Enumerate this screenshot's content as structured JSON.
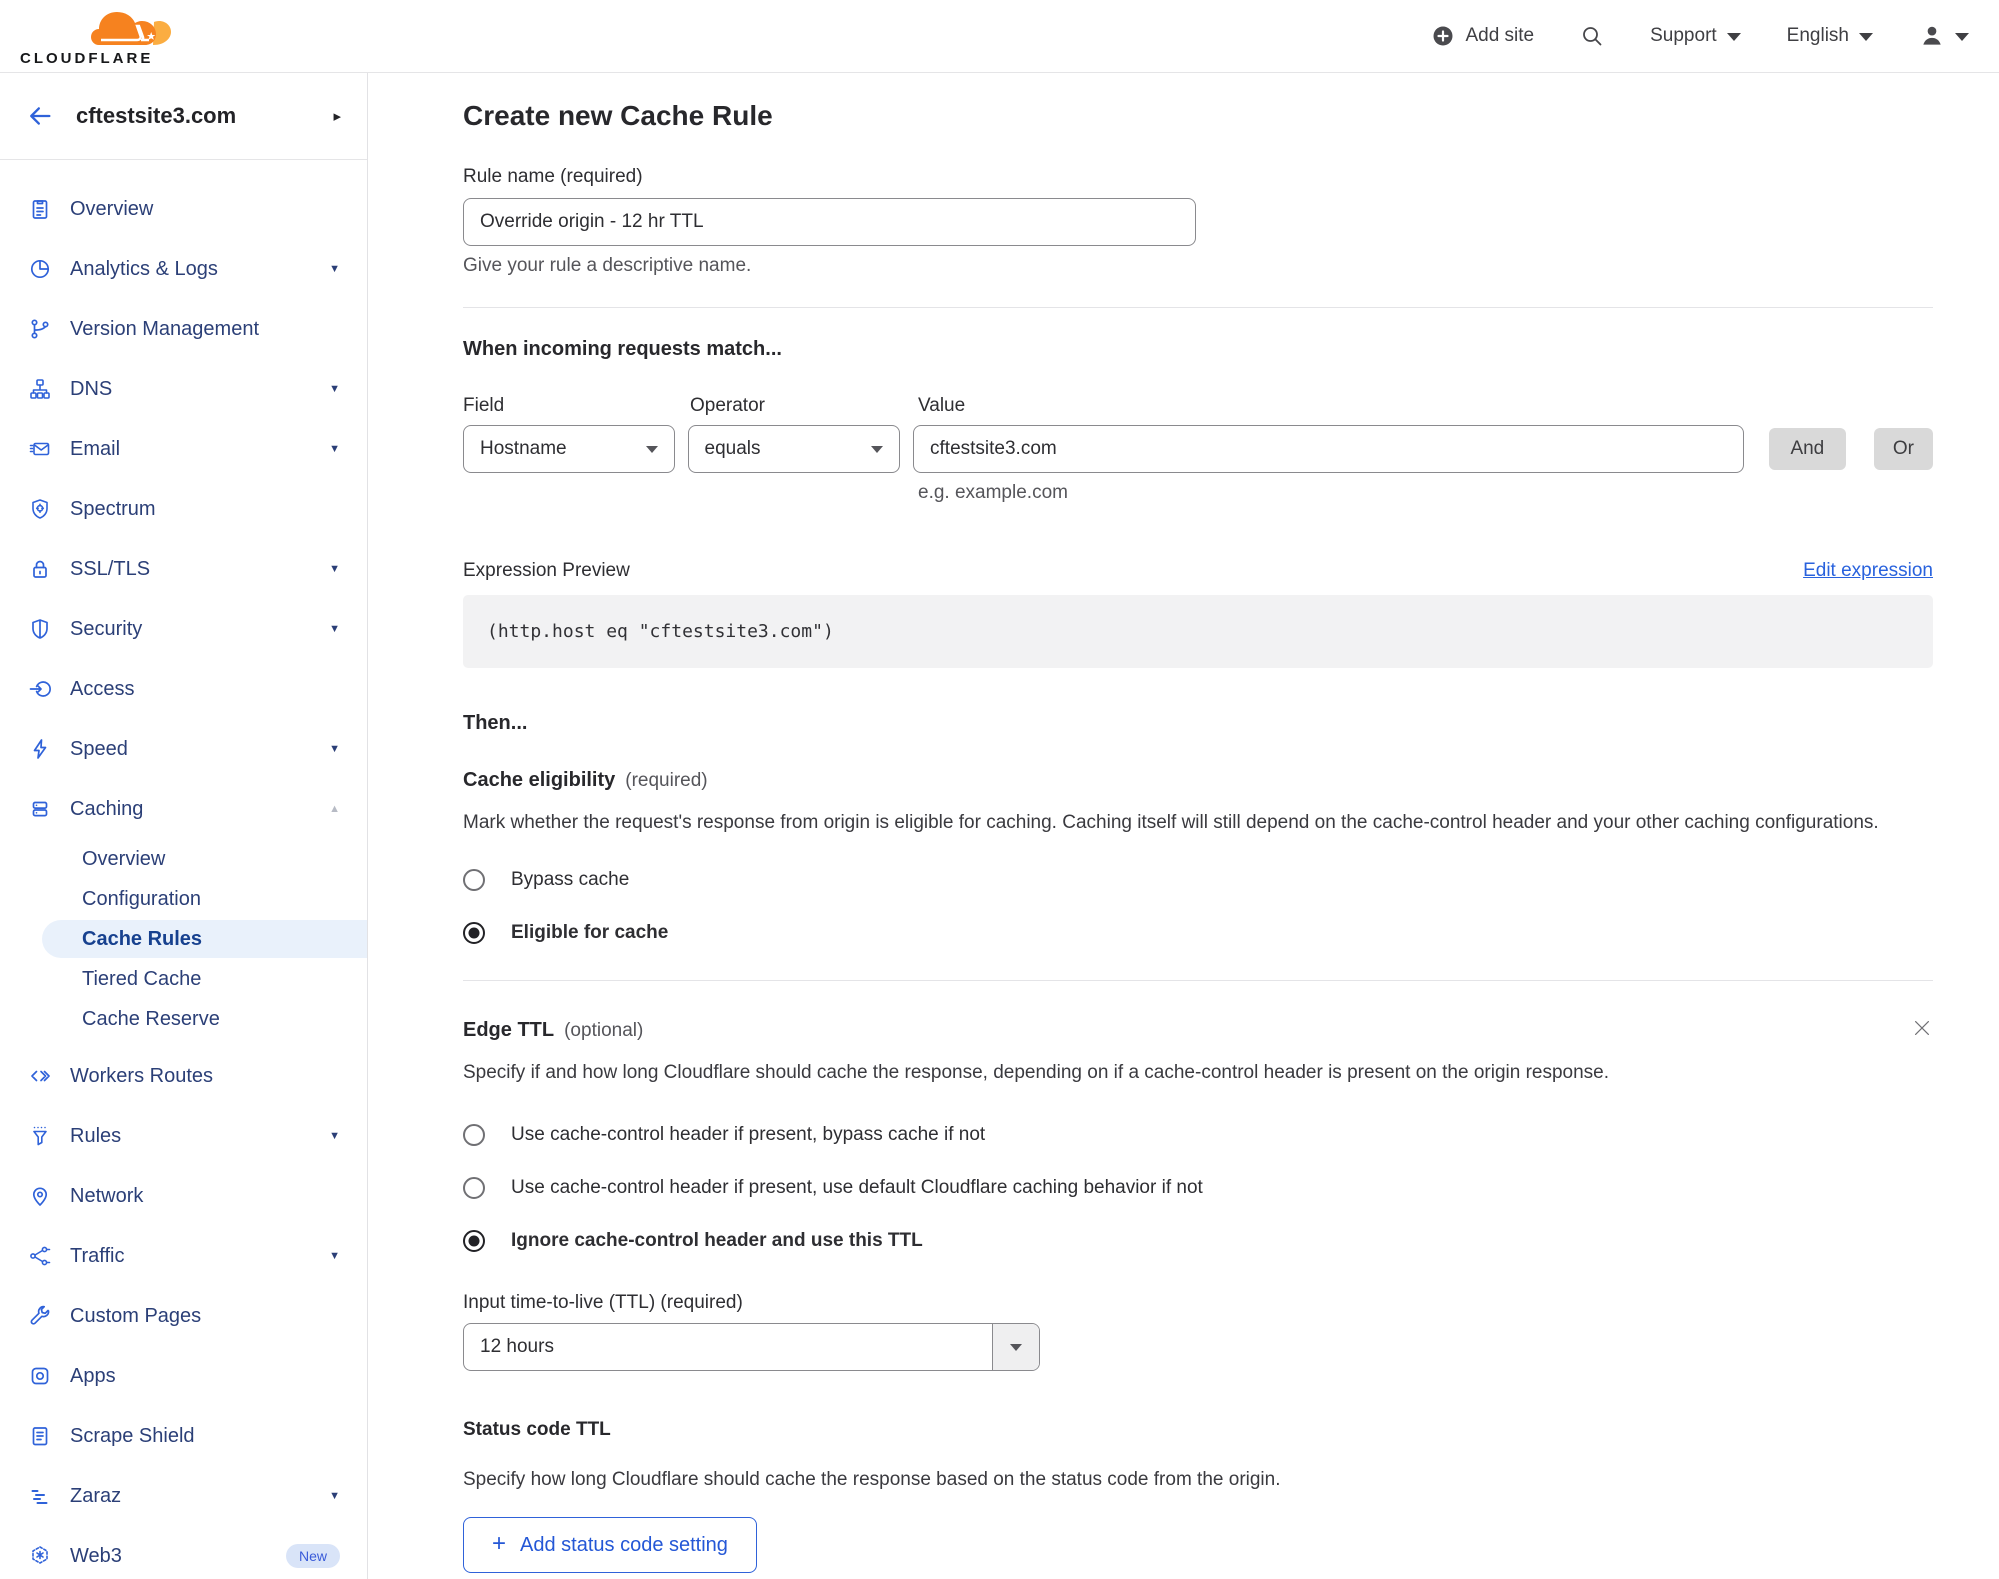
{
  "colors": {
    "brand_orange": "#f6821f",
    "brand_orange_light": "#fbad41",
    "nav_icon_blue": "#2f62d9",
    "nav_text_navy": "#2b3f77",
    "active_pill_bg": "#e9f1fb",
    "active_text": "#17418f",
    "link_blue": "#2962dd",
    "button_gray": "#d9d9d9"
  },
  "header": {
    "logo_text": "CLOUDFLARE",
    "add_site_label": "Add site",
    "support_label": "Support",
    "language_label": "English"
  },
  "sidebar": {
    "site_name": "cftestsite3.com",
    "items": [
      {
        "label": "Overview"
      },
      {
        "label": "Analytics & Logs"
      },
      {
        "label": "Version Management"
      },
      {
        "label": "DNS"
      },
      {
        "label": "Email"
      },
      {
        "label": "Spectrum"
      },
      {
        "label": "SSL/TLS"
      },
      {
        "label": "Security"
      },
      {
        "label": "Access"
      },
      {
        "label": "Speed"
      },
      {
        "label": "Caching"
      },
      {
        "label": "Workers Routes"
      },
      {
        "label": "Rules"
      },
      {
        "label": "Network"
      },
      {
        "label": "Traffic"
      },
      {
        "label": "Custom Pages"
      },
      {
        "label": "Apps"
      },
      {
        "label": "Scrape Shield"
      },
      {
        "label": "Zaraz"
      },
      {
        "label": "Web3",
        "badge": "New"
      }
    ],
    "caching_sub": [
      {
        "label": "Overview"
      },
      {
        "label": "Configuration"
      },
      {
        "label": "Cache Rules",
        "active": true
      },
      {
        "label": "Tiered Cache"
      },
      {
        "label": "Cache Reserve"
      }
    ]
  },
  "main": {
    "title": "Create new Cache Rule",
    "rule_name": {
      "label": "Rule name (required)",
      "value": "Override origin - 12 hr TTL",
      "help": "Give your rule a descriptive name."
    },
    "match": {
      "heading": "When incoming requests match...",
      "field_label": "Field",
      "field_value": "Hostname",
      "operator_label": "Operator",
      "operator_value": "equals",
      "value_label": "Value",
      "value_value": "cftestsite3.com",
      "value_help": "e.g. example.com",
      "and_label": "And",
      "or_label": "Or"
    },
    "expression": {
      "label": "Expression Preview",
      "edit_link": "Edit expression",
      "code": "(http.host eq \"cftestsite3.com\")"
    },
    "then_heading": "Then...",
    "cache_eligibility": {
      "heading": "Cache eligibility",
      "note": "(required)",
      "description": "Mark whether the request's response from origin is eligible for caching. Caching itself will still depend on the cache-control header and your other caching configurations.",
      "options": [
        {
          "label": "Bypass cache",
          "selected": false
        },
        {
          "label": "Eligible for cache",
          "selected": true
        }
      ]
    },
    "edge_ttl": {
      "heading": "Edge TTL",
      "note": "(optional)",
      "description": "Specify if and how long Cloudflare should cache the response, depending on if a cache-control header is present on the origin response.",
      "options": [
        {
          "label": "Use cache-control header if present, bypass cache if not",
          "selected": false
        },
        {
          "label": "Use cache-control header if present, use default Cloudflare caching behavior if not",
          "selected": false
        },
        {
          "label": "Ignore cache-control header and use this TTL",
          "selected": true
        }
      ],
      "ttl_label": "Input time-to-live (TTL) (required)",
      "ttl_value": "12 hours"
    },
    "status_code_ttl": {
      "heading": "Status code TTL",
      "description": "Specify how long Cloudflare should cache the response based on the status code from the origin.",
      "add_button_label": "Add status code setting"
    }
  }
}
